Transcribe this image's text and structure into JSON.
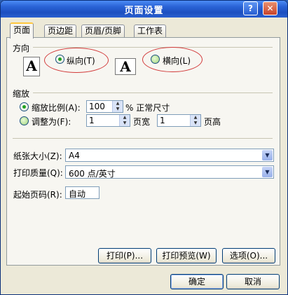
{
  "window": {
    "title": "页面设置"
  },
  "tabs": [
    {
      "label": "页面"
    },
    {
      "label": "页边距"
    },
    {
      "label": "页眉/页脚"
    },
    {
      "label": "工作表"
    }
  ],
  "orientation": {
    "heading": "方向",
    "portrait": {
      "label": "纵向(T)",
      "hotkey": "T",
      "selected": true
    },
    "landscape": {
      "label": "横向(L)",
      "hotkey": "L",
      "selected": false
    },
    "icon_letter": "A"
  },
  "scaling": {
    "heading": "缩放",
    "adjust_to": {
      "label": "缩放比例(A):",
      "value": "100",
      "suffix": "% 正常尺寸",
      "selected": true
    },
    "fit_to": {
      "label": "调整为(F):",
      "wide_value": "1",
      "wide_unit": "页宽",
      "tall_value": "1",
      "tall_unit": "页高",
      "selected": false
    }
  },
  "paper": {
    "size_label": "纸张大小(Z):",
    "size_value": "A4",
    "quality_label": "打印质量(Q):",
    "quality_value": "600 点/英寸",
    "first_page_label": "起始页码(R):",
    "first_page_value": "自动"
  },
  "buttons": {
    "print": "打印(P)...",
    "preview": "打印预览(W)",
    "options": "选项(O)...",
    "ok": "确定",
    "cancel": "取消"
  },
  "colors": {
    "title_bar": "#2a63d6",
    "dialog_bg": "#ece9d8",
    "annotation": "#d23a3a"
  }
}
